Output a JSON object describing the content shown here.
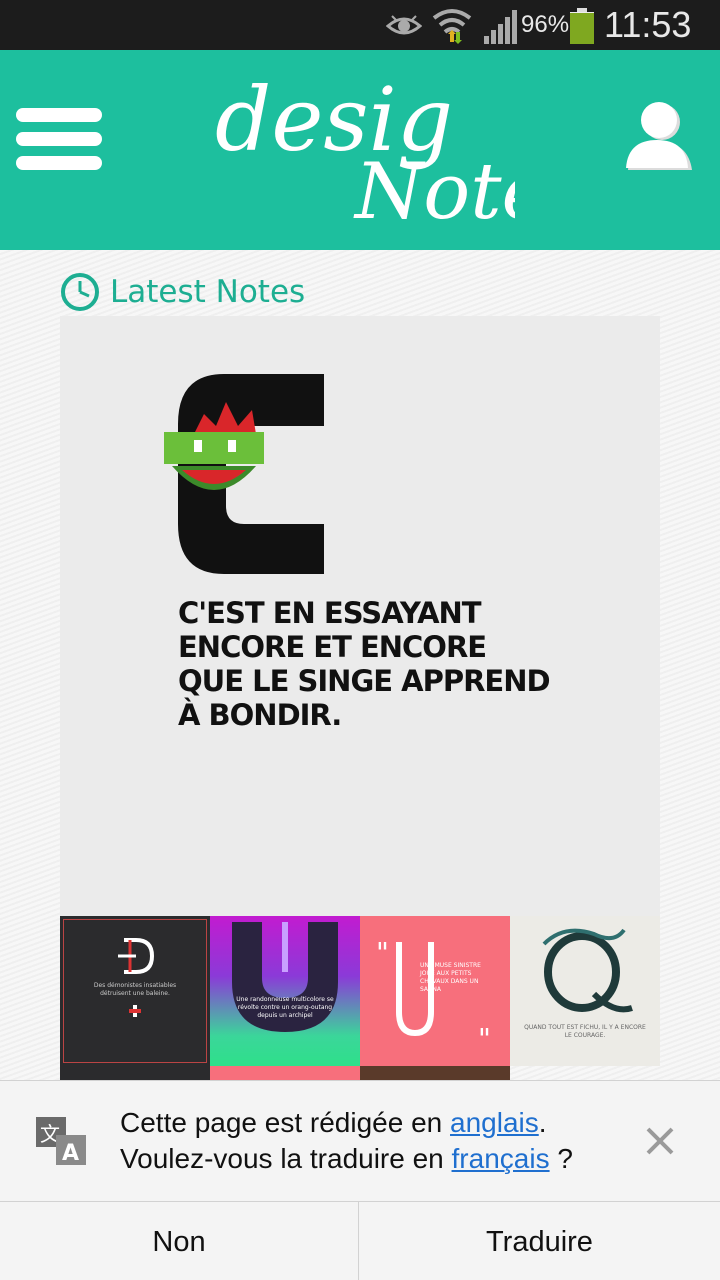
{
  "status_bar": {
    "battery_percent": "96%",
    "time": "11:53",
    "battery_level": 0.96,
    "icons": [
      "eye-icon",
      "wifi-icon",
      "signal-icon",
      "battery-icon"
    ]
  },
  "app_bar": {
    "background": "#1dbf9e",
    "logo_text_line1": "desig",
    "logo_text_line2": "Note",
    "icons": [
      "menu-icon",
      "user-icon"
    ]
  },
  "section": {
    "title": "Latest Notes",
    "accent": "#1dae92"
  },
  "featured_note": {
    "quote_lines": [
      "C'EST EN ESSAYANT",
      "ENCORE ET ENCORE",
      "QUE LE SINGE APPREND",
      "À BONDIR."
    ]
  },
  "thumbnails": [
    {
      "caption": "Des démonistes insatiables détruisent une baleine."
    },
    {
      "caption": "Une randonneuse multicolore se révolte contre un orang-outang depuis un archipel"
    },
    {
      "caption": "UNE MUSE SINISTRE JOUE AUX PETITS CHEVAUX DANS UN SAUNA"
    },
    {
      "caption": "QUAND TOUT EST FICHU, IL Y A ENCORE LE COURAGE."
    }
  ],
  "translate_bar": {
    "line1_prefix": "Cette page est rédigée en ",
    "line1_link": "anglais",
    "line1_suffix": ".",
    "line2_prefix": "Voulez-vous la traduire en ",
    "line2_link": "français",
    "line2_suffix": " ?",
    "no_label": "Non",
    "translate_label": "Traduire",
    "link_color": "#1f6fcf"
  }
}
